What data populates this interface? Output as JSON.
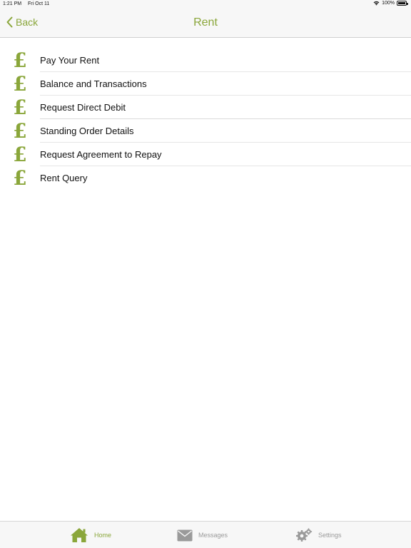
{
  "status_bar": {
    "time": "1:21 PM",
    "date": "Fri Oct 11",
    "battery": "100%"
  },
  "nav": {
    "back_label": "Back",
    "title": "Rent"
  },
  "menu": [
    {
      "label": "Pay Your Rent",
      "icon": "pound-icon"
    },
    {
      "label": "Balance and Transactions",
      "icon": "pound-icon"
    },
    {
      "label": "Request Direct Debit",
      "icon": "pound-icon"
    },
    {
      "label": "Standing Order Details",
      "icon": "pound-icon"
    },
    {
      "label": "Request Agreement to Repay",
      "icon": "pound-icon"
    },
    {
      "label": "Rent Query",
      "icon": "pound-icon"
    }
  ],
  "tabs": [
    {
      "label": "Home",
      "icon": "home-icon",
      "active": true
    },
    {
      "label": "Messages",
      "icon": "envelope-icon",
      "active": false
    },
    {
      "label": "Settings",
      "icon": "gear-icon",
      "active": false
    }
  ],
  "colors": {
    "accent": "#8aa63a",
    "inactive": "#9a9a9a",
    "bar_background": "#f7f7f7"
  }
}
